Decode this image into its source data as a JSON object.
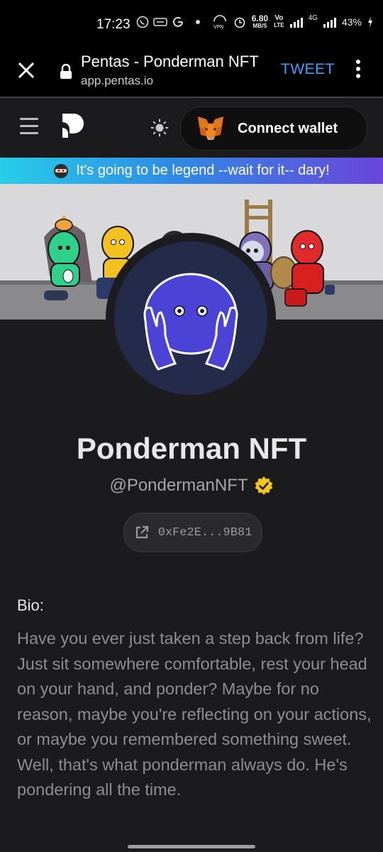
{
  "status_bar": {
    "time": "17:23",
    "speed": "6.80",
    "speed_unit": "MB/S",
    "net1": "Vo",
    "net2": "LTE",
    "net3": "4G",
    "battery": "43%"
  },
  "browser": {
    "page_title": "Pentas - Ponderman NFT",
    "domain": "app.pentas.io",
    "tweet_label": "TWEET"
  },
  "header": {
    "connect_wallet": "Connect wallet"
  },
  "banner": {
    "text": "It's going to be legend --wait for it-- dary!"
  },
  "profile": {
    "name": "Ponderman NFT",
    "handle": "@PondermanNFT",
    "address": "0xFe2E...9B81",
    "verified": true
  },
  "bio": {
    "label": "Bio:",
    "text": "Have you ever just taken a step back from life? Just sit somewhere comfortable, rest your head on your hand, and ponder? Maybe for no reason, maybe you're reflecting on your actions, or maybe you remembered something sweet. Well, that's what ponderman always do. He's pondering all the time."
  },
  "colors": {
    "background": "#1b1b1d",
    "accent_blue": "#3ea0ff",
    "verified": "#f5c518"
  }
}
